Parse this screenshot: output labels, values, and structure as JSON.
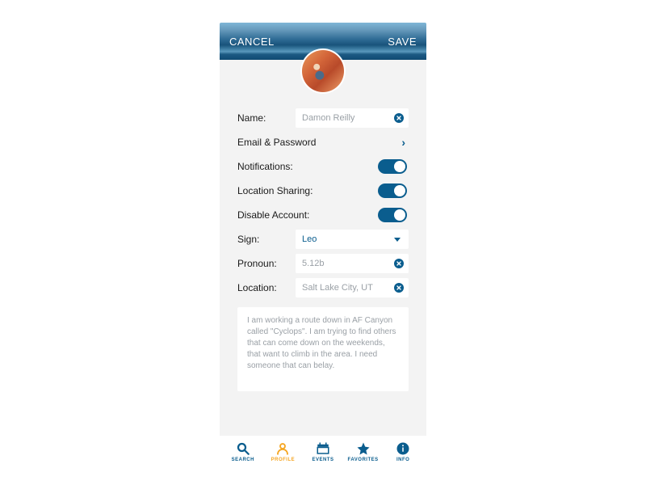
{
  "header": {
    "cancel": "CANCEL",
    "save": "SAVE"
  },
  "fields": {
    "name_label": "Name:",
    "name_value": "Damon Reilly",
    "email_label": "Email & Password",
    "notifications_label": "Notifications:",
    "notifications_on": true,
    "location_sharing_label": "Location Sharing:",
    "location_sharing_on": true,
    "disable_account_label": "Disable Account:",
    "disable_account_on": true,
    "sign_label": "Sign:",
    "sign_value": "Leo",
    "pronoun_label": "Pronoun:",
    "pronoun_value": "5.12b",
    "location_label": "Location:",
    "location_value": "Salt Lake City, UT",
    "bio": "I am working a route down in AF Canyon called \"Cyclops\".  I am trying to find others that can come down on the weekends, that want to climb in the area.  I need someone that can belay."
  },
  "tabs": {
    "search": "SEARCH",
    "profile": "PROFILE",
    "events": "EVENTS",
    "favorites": "FAVORITES",
    "info": "INFO"
  }
}
